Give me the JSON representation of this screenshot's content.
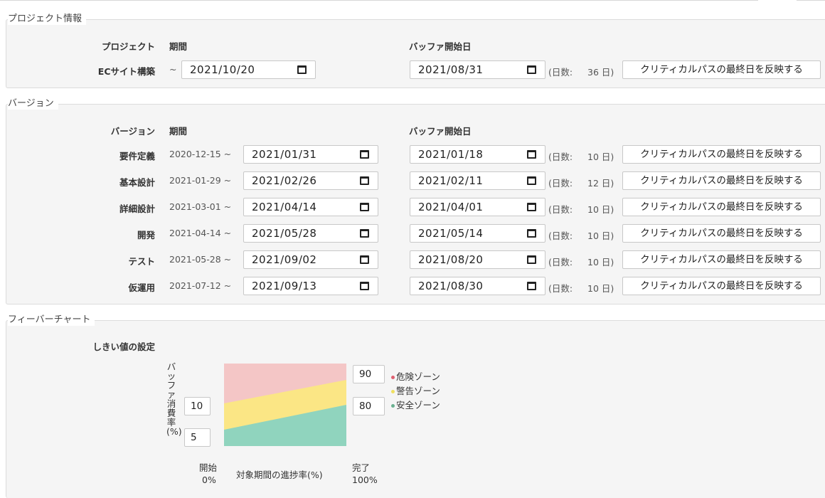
{
  "project": {
    "section_title": "プロジェクト情報",
    "col_project": "プロジェクト",
    "col_period": "期間",
    "col_buffer": "バッファ開始日",
    "name": "ECサイト構築",
    "tilde": "~",
    "end_date": "2021/10/20",
    "buffer_date": "2021/08/31",
    "days_prefix": "(日数:",
    "days_value": "36 日)",
    "reflect_button": "クリティカルパスの最終日を反映する"
  },
  "version": {
    "section_title": "バージョン",
    "col_version": "バージョン",
    "col_period": "期間",
    "col_buffer": "バッファ開始日",
    "rows": [
      {
        "name": "要件定義",
        "start": "2020-12-15 ~",
        "end": "2021/01/31",
        "buffer": "2021/01/18",
        "days_prefix": "(日数:",
        "days": "10 日)",
        "button": "クリティカルパスの最終日を反映する"
      },
      {
        "name": "基本設計",
        "start": "2021-01-29 ~",
        "end": "2021/02/26",
        "buffer": "2021/02/11",
        "days_prefix": "(日数:",
        "days": "12 日)",
        "button": "クリティカルパスの最終日を反映する"
      },
      {
        "name": "詳細設計",
        "start": "2021-03-01 ~",
        "end": "2021/04/14",
        "buffer": "2021/04/01",
        "days_prefix": "(日数:",
        "days": "10 日)",
        "button": "クリティカルパスの最終日を反映する"
      },
      {
        "name": "開発",
        "start": "2021-04-14 ~",
        "end": "2021/05/28",
        "buffer": "2021/05/14",
        "days_prefix": "(日数:",
        "days": "10 日)",
        "button": "クリティカルパスの最終日を反映する"
      },
      {
        "name": "テスト",
        "start": "2021-05-28 ~",
        "end": "2021/09/02",
        "buffer": "2021/08/20",
        "days_prefix": "(日数:",
        "days": "10 日)",
        "button": "クリティカルパスの最終日を反映する"
      },
      {
        "name": "仮運用",
        "start": "2021-07-12 ~",
        "end": "2021/09/13",
        "buffer": "2021/08/30",
        "days_prefix": "(日数:",
        "days": "10 日)",
        "button": "クリティカルパスの最終日を反映する"
      }
    ]
  },
  "fever": {
    "section_title": "フィーバーチャート",
    "threshold_label": "しきい値の設定",
    "y_axis_label": "バッファ消費率(%)",
    "x_axis_label": "対象期間の進捗率(%)",
    "start_label": "開始",
    "start_pct": "0%",
    "end_label": "完了",
    "end_pct": "100%",
    "left_upper": "10",
    "left_lower": "5",
    "right_upper": "90",
    "right_lower": "80",
    "legend": [
      {
        "label": "危険ゾーン",
        "color": "#e06070"
      },
      {
        "label": "警告ゾーン",
        "color": "#f0e060"
      },
      {
        "label": "安全ゾーン",
        "color": "#6ab090"
      }
    ],
    "zone_colors": {
      "danger": "#f4c6c6",
      "warning": "#fbe685",
      "safe": "#90d4be"
    }
  }
}
